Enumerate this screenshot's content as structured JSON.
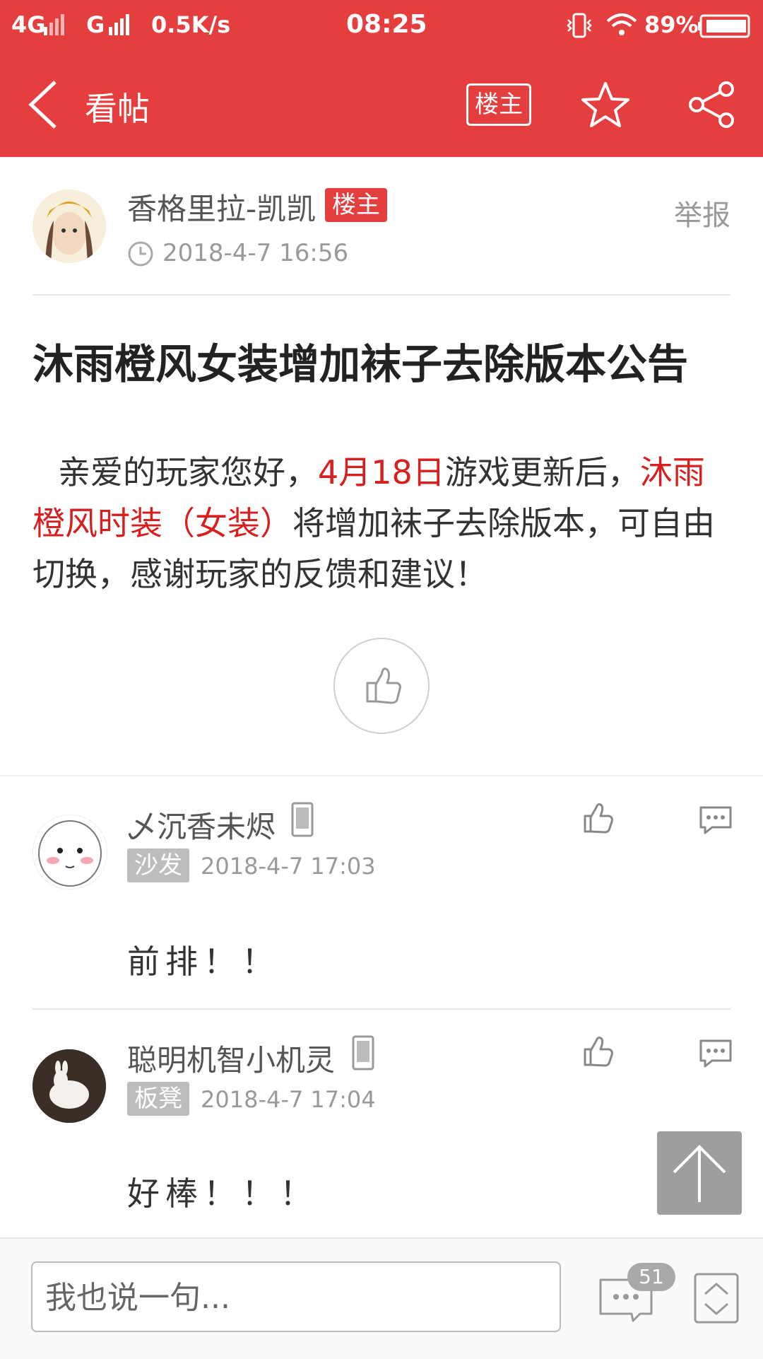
{
  "status_bar": {
    "network_left": "4G",
    "network_right": "G",
    "speed": "0.5K/s",
    "time": "08:25",
    "battery": "89%"
  },
  "title_bar": {
    "title": "看帖",
    "owner_filter_label": "楼主",
    "icons": [
      "back-arrow-icon",
      "star-icon",
      "share-icon"
    ]
  },
  "post": {
    "author": "香格里拉-凯凯",
    "owner_badge": "楼主",
    "report_label": "举报",
    "time": "2018-4-7 16:56",
    "title": "沐雨橙风女装增加袜子去除版本公告",
    "body": {
      "p1": "亲爱的玩家您好，",
      "p2_red": "4月18日",
      "p3": "游戏更新后，",
      "p4_red": "沐雨橙风时装（女装）",
      "p5": "将增加袜子去除版本，可自由切换，感谢玩家的反馈和建议！"
    }
  },
  "comments": [
    {
      "user": "乄沉香未烬",
      "floor": "沙发",
      "time": "2018-4-7 17:03",
      "text": "前排！！"
    },
    {
      "user": "聪明机智小机灵",
      "floor": "板凳",
      "time": "2018-4-7 17:04",
      "text": "好棒！！！"
    }
  ],
  "bottom_bar": {
    "input_placeholder": "我也说一句...",
    "comment_count": "51"
  },
  "colors": {
    "accent": "#e53e3e",
    "highlight_text": "#d62020",
    "muted": "#999999"
  }
}
